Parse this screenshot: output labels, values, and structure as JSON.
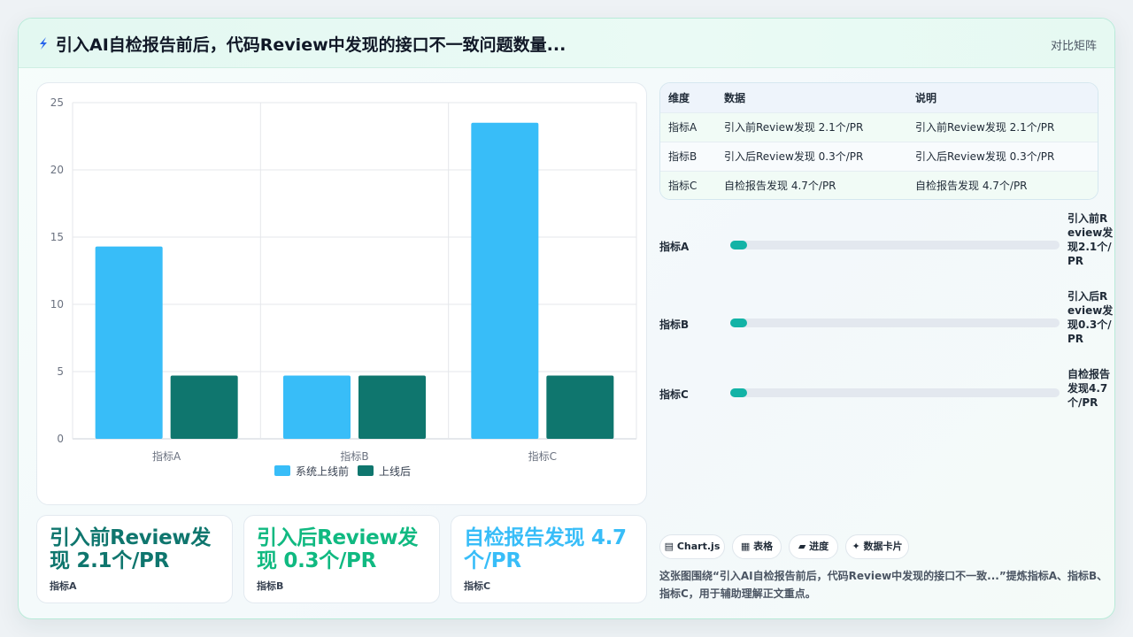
{
  "header": {
    "title": "引入AI自检报告前后，代码Review中发现的接口不一致问题数量...",
    "mode_label": "对比矩阵"
  },
  "chart_data": {
    "type": "bar",
    "categories": [
      "指标A",
      "指标B",
      "指标C"
    ],
    "series": [
      {
        "name": "系统上线前",
        "values": [
          14.3,
          4.7,
          23.5
        ],
        "color": "#38bdf8"
      },
      {
        "name": "上线后",
        "values": [
          4.7,
          4.7,
          4.7
        ],
        "color": "#0f766e"
      }
    ],
    "ylim": [
      0,
      25
    ],
    "yticks": [
      0,
      5,
      10,
      15,
      20,
      25
    ],
    "grid": true,
    "legend": "bottom"
  },
  "kpis": [
    {
      "value": "引入前Review发现 2.1个/PR",
      "label": "指标A",
      "color": "#0f766e"
    },
    {
      "value": "引入后Review发现 0.3个/PR",
      "label": "指标B",
      "color": "#10b981"
    },
    {
      "value": "自检报告发现 4.7个/PR",
      "label": "指标C",
      "color": "#38bdf8"
    }
  ],
  "table": {
    "headers": [
      "维度",
      "数据",
      "说明"
    ],
    "rows": [
      [
        "指标A",
        "引入前Review发现 2.1个/PR",
        "引入前Review发现 2.1个/PR"
      ],
      [
        "指标B",
        "引入后Review发现 0.3个/PR",
        "引入后Review发现 0.3个/PR"
      ],
      [
        "指标C",
        "自检报告发现 4.7个/PR",
        "自检报告发现 4.7个/PR"
      ]
    ]
  },
  "progress": [
    {
      "label": "指标A",
      "value_text": "引入前Review发现2.1个/PR",
      "fraction": 0.05
    },
    {
      "label": "指标B",
      "value_text": "引入后Review发现0.3个/PR",
      "fraction": 0.05
    },
    {
      "label": "指标C",
      "value_text": "自检报告发现4.7个/PR",
      "fraction": 0.05
    }
  ],
  "chips": [
    {
      "icon": "chart-icon",
      "label": "Chart.js"
    },
    {
      "icon": "table-icon",
      "label": "表格"
    },
    {
      "icon": "progress-icon",
      "label": "进度"
    },
    {
      "icon": "sparkle-icon",
      "label": "数据卡片"
    }
  ],
  "summary": "这张图围绕“引入AI自检报告前后，代码Review中发现的接口不一致...”提炼指标A、指标B、指标C，用于辅助理解正文重点。"
}
